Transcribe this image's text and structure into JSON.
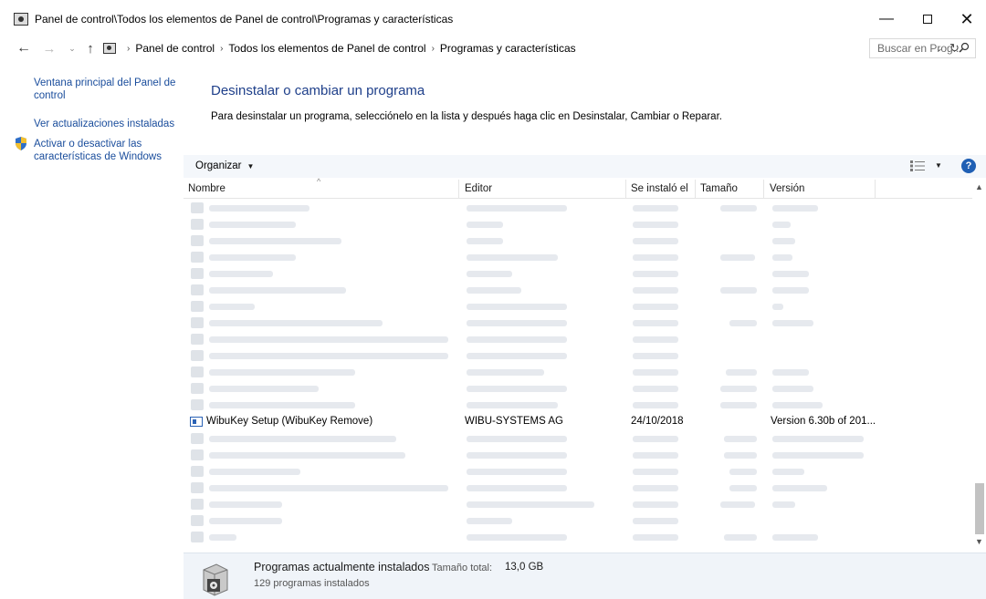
{
  "window": {
    "title": "Panel de control\\Todos los elementos de Panel de control\\Programas y características",
    "minimize_glyph": "—",
    "close_glyph": "✕"
  },
  "nav": {
    "back_glyph": "←",
    "forward_glyph": "→",
    "recent_glyph": "⌄",
    "up_glyph": "↑"
  },
  "address": {
    "crumbs": [
      "Panel de control",
      "Todos los elementos de Panel de control",
      "Programas y características"
    ],
    "separator": "›",
    "dropdown_glyph": "⌄",
    "refresh_glyph": "↻"
  },
  "search": {
    "placeholder": "Buscar en Prog...",
    "icon": "search-icon"
  },
  "sidebar": {
    "items": [
      {
        "label": "Ventana principal del Panel de control"
      },
      {
        "label": "Ver actualizaciones instaladas"
      },
      {
        "label": "Activar o desactivar las características de Windows",
        "icon": "shield-icon"
      }
    ]
  },
  "main": {
    "heading": "Desinstalar o cambiar un programa",
    "description": "Para desinstalar un programa, selecciónelo en la lista y después haga clic en Desinstalar, Cambiar o Reparar."
  },
  "toolbar": {
    "organize_label": "Organizar",
    "dropdown_glyph": "▼",
    "help_label": "?"
  },
  "list": {
    "columns": [
      "Nombre",
      "Editor",
      "Se instaló el",
      "Tamaño",
      "Versión"
    ],
    "sort_glyph": "^",
    "visible_row": {
      "name": "WibuKey Setup (WibuKey Remove)",
      "editor": "WIBU-SYSTEMS AG",
      "installed": "24/10/2018",
      "size": "",
      "version": "Version 6.30b of 201..."
    }
  },
  "scrollbar": {
    "up_glyph": "▲",
    "down_glyph": "▼"
  },
  "details": {
    "title": "Programas actualmente instalados",
    "size_label": "Tamaño total:",
    "size_value": "13,0 GB",
    "count": "129 programas instalados"
  },
  "colors": {
    "link": "#1a4d9c",
    "heading": "#1e3f8a",
    "toolbar_bg": "#f4f7fb",
    "details_bg": "#f0f4f9",
    "help": "#1f5fb4"
  }
}
